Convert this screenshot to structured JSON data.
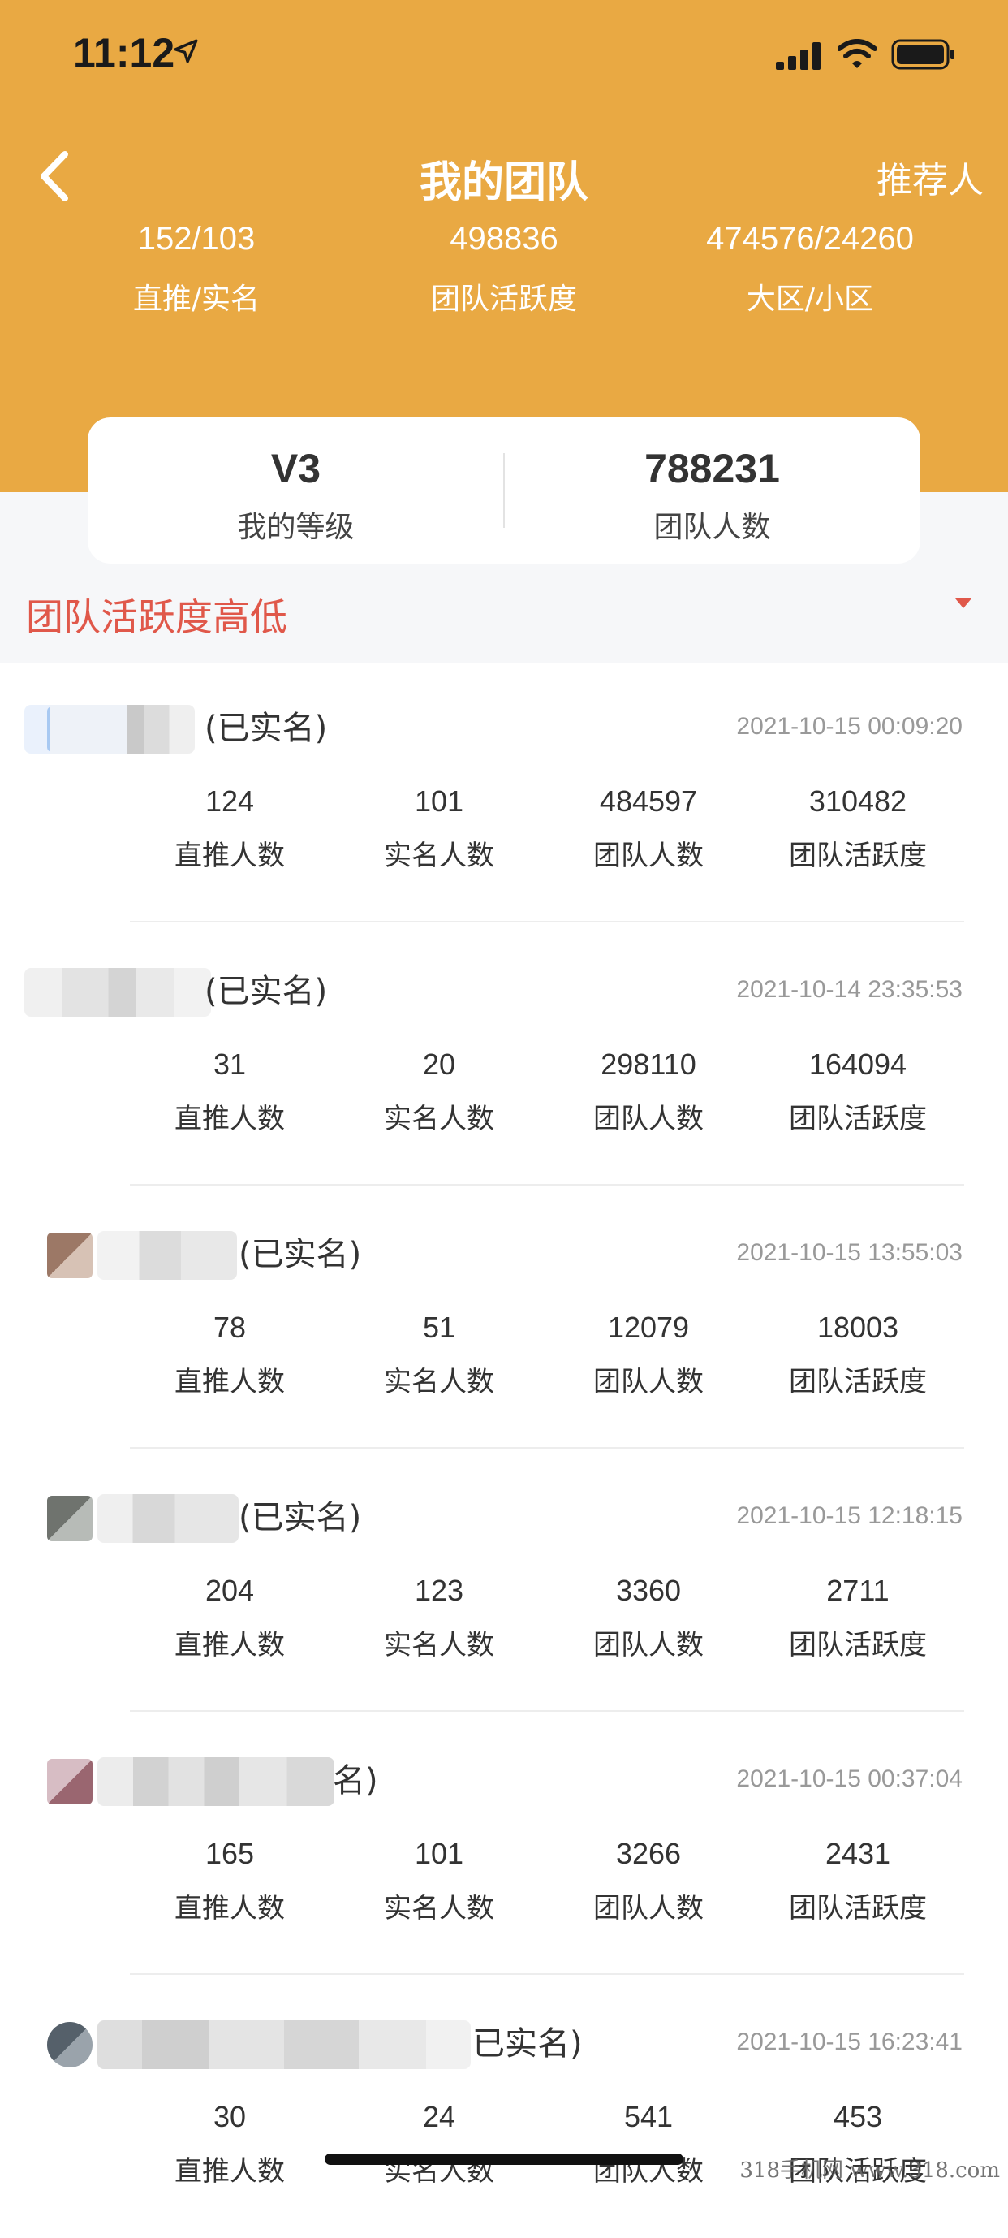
{
  "status_bar": {
    "time": "11:12",
    "icons": [
      "location-arrow-icon",
      "cellular-signal-icon",
      "wifi-icon",
      "battery-icon"
    ]
  },
  "nav": {
    "title": "我的团队",
    "right_label": "推荐人",
    "back_icon": "chevron-left-icon"
  },
  "summary": [
    {
      "value": "152/103",
      "label": "直推/实名"
    },
    {
      "value": "498836",
      "label": "团队活跃度"
    },
    {
      "value": "474576/24260",
      "label": "大区/小区"
    }
  ],
  "level_card": {
    "level_value": "V3",
    "level_label": "我的等级",
    "team_value": "788231",
    "team_label": "团队人数"
  },
  "sort": {
    "label": "团队活跃度高低",
    "caret_icon": "caret-down-icon"
  },
  "stat_labels": {
    "direct": "直推人数",
    "verified": "实名人数",
    "team": "团队人数",
    "activity": "团队活跃度"
  },
  "members": [
    {
      "suffix": "(已实名)",
      "time": "2021-10-15 00:09:20",
      "direct": "124",
      "verified": "101",
      "team": "484597",
      "activity": "310482"
    },
    {
      "suffix": "(已实名)",
      "time": "2021-10-14 23:35:53",
      "direct": "31",
      "verified": "20",
      "team": "298110",
      "activity": "164094"
    },
    {
      "suffix": "(已实名)",
      "time": "2021-10-15 13:55:03",
      "direct": "78",
      "verified": "51",
      "team": "12079",
      "activity": "18003"
    },
    {
      "suffix": "(已实名)",
      "time": "2021-10-15 12:18:15",
      "direct": "204",
      "verified": "123",
      "team": "3360",
      "activity": "2711"
    },
    {
      "suffix": "名)",
      "time": "2021-10-15 00:37:04",
      "direct": "165",
      "verified": "101",
      "team": "3266",
      "activity": "2431"
    },
    {
      "suffix": "已实名)",
      "time": "2021-10-15 16:23:41",
      "direct": "30",
      "verified": "24",
      "team": "541",
      "activity": "453"
    }
  ],
  "colors": {
    "header": "#e9a943",
    "sort_text": "#e0584a"
  },
  "watermark": "318手机网 www.318.com"
}
